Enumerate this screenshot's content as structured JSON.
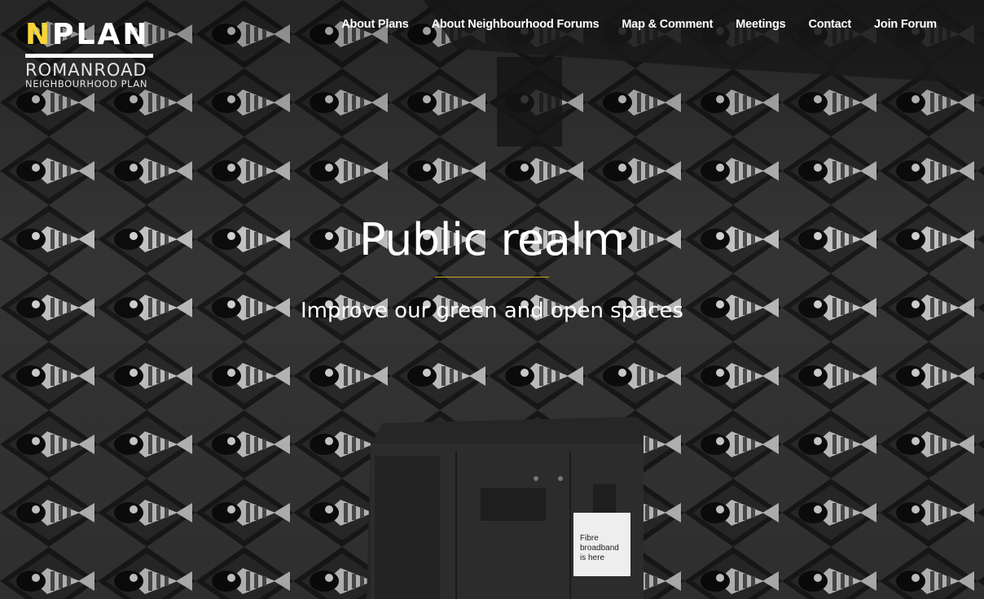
{
  "logo": {
    "word_first": "N",
    "word_rest": "PLAN",
    "line1": "ROMANROAD",
    "line2": "NEIGHBOURHOOD PLAN"
  },
  "nav": {
    "items": [
      {
        "label": "About Plans"
      },
      {
        "label": "About Neighbourhood Forums"
      },
      {
        "label": "Map & Comment"
      },
      {
        "label": "Meetings"
      },
      {
        "label": "Contact"
      },
      {
        "label": "Join Forum"
      }
    ]
  },
  "hero": {
    "title": "Public realm",
    "subtitle": "Improve our green and open spaces",
    "background": "black-and-white photo of a wall mural with a repeating fish pattern and a green street cabinet in front",
    "cabinet_sign": [
      "Fibre",
      "broadband",
      "is here"
    ]
  },
  "colors": {
    "logo_accent": "#f4d53a",
    "title_rule": "#c9a825",
    "text": "#ffffff"
  }
}
